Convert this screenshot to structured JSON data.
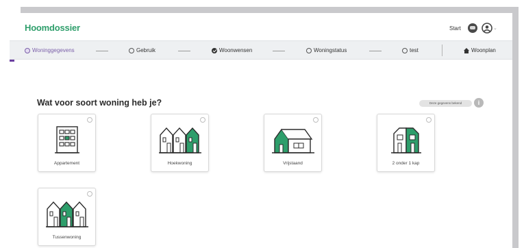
{
  "header": {
    "logo": "Hoomdossier",
    "start_label": "Start",
    "caret": "⌄"
  },
  "steps": [
    {
      "label": "Woninggegevens",
      "state": "active"
    },
    {
      "label": "Gebruik",
      "state": "open"
    },
    {
      "label": "Woonwensen",
      "state": "done"
    },
    {
      "label": "Woningstatus",
      "state": "open"
    },
    {
      "label": "test",
      "state": "open"
    }
  ],
  "woonplan_label": "Woonplan",
  "main": {
    "question": "Wat voor soort woning heb je?",
    "skip_label": "Deze gegevens bekend",
    "info_glyph": "i"
  },
  "house_types": [
    {
      "label": "Appartement",
      "icon": "apartment-icon"
    },
    {
      "label": "Hoekwoning",
      "icon": "corner-house-icon"
    },
    {
      "label": "Vrijstaand",
      "icon": "detached-house-icon"
    },
    {
      "label": "2 onder 1 kap",
      "icon": "semi-detached-house-icon"
    },
    {
      "label": "Tussenwoning",
      "icon": "terraced-house-icon"
    }
  ],
  "colors": {
    "brand_green": "#2e9e6b",
    "accent_purple": "#6b3fa0",
    "icon_outline": "#2b2b2b"
  }
}
